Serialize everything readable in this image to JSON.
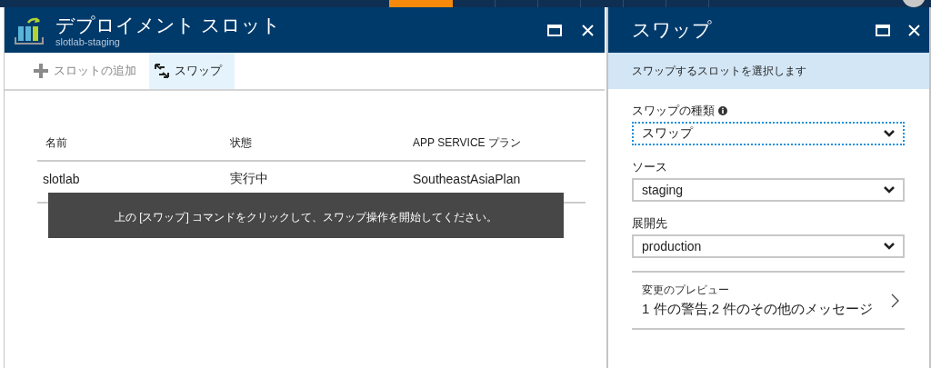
{
  "top_bar": {
    "tabs": [
      {
        "selected": true
      },
      {
        "selected": false
      },
      {
        "selected": false
      },
      {
        "selected": false
      },
      {
        "selected": false
      },
      {
        "selected": false
      },
      {
        "selected": false
      }
    ]
  },
  "main_blade": {
    "title": "デプロイメント スロット",
    "subtitle": "slotlab-staging",
    "toolbar": [
      {
        "kind": "add",
        "label": "スロットの追加",
        "disabled": true,
        "selected": false
      },
      {
        "kind": "swap",
        "label": "スワップ",
        "disabled": false,
        "selected": true
      }
    ],
    "table": {
      "columns": [
        "名前",
        "状態",
        "APP SERVICE プラン"
      ],
      "rows": [
        [
          "slotlab",
          "実行中",
          "SoutheastAsiaPlan"
        ]
      ]
    },
    "tooltip": "上の [スワップ] コマンドをクリックして、スワップ操作を開始してください。"
  },
  "swap_blade": {
    "title": "スワップ",
    "banner": "スワップするスロットを選択します",
    "fields": [
      {
        "label": "スワップの種類",
        "info": true,
        "value": "スワップ",
        "focused": true
      },
      {
        "label": "ソース",
        "info": false,
        "value": "staging",
        "focused": false
      },
      {
        "label": "展開先",
        "info": false,
        "value": "production",
        "focused": false
      }
    ],
    "preview": {
      "label": "変更のプレビュー",
      "text": "1 件の警告,2 件のその他のメッセージ"
    }
  }
}
